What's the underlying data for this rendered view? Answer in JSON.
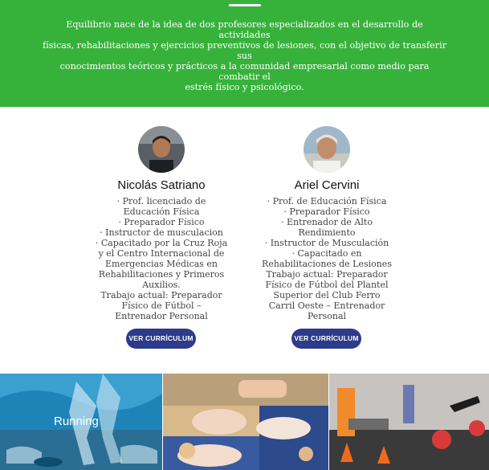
{
  "intro": {
    "lines": [
      "Equilibrio nace de la idea de dos profesores especializados en el desarrollo de actividades",
      "físicas, rehabilitaciones y ejercicios preventivos de lesiones, con el objetivo de transferir sus",
      "conocimientos teóricos y prácticos a la comunidad empresarial como medio para combatir el",
      "estrés físico y psicológico."
    ]
  },
  "team": {
    "members": [
      {
        "name": "Nicolás Satriano",
        "lines": [
          "· Prof. licenciado de",
          "Educación Física",
          "· Preparador Físico",
          "· Instructor de musculacion",
          "· Capacitado por la Cruz Roja",
          "y el Centro Internacional de",
          "Emergencias Médicas en",
          "Rehabilitaciones y Primeros",
          "Auxilios.",
          "Trabajo actual: Preparador",
          "Físico de Fútbol  –",
          "Entrenador Personal"
        ],
        "button_label": "VER CURRÍCULUM"
      },
      {
        "name": "Ariel Cervini",
        "lines": [
          "· Prof. de Educación Física",
          "· Preparador Físico",
          "· Entrenador de Alto",
          "Rendimiento",
          "· Instructor de Musculación",
          "· Capacitado en",
          "Rehabilitaciones de Lesiones",
          "Trabajo actual: Preparador",
          "Físico de Fútbol  del Plantel",
          "Superior del Club Ferro",
          "Carril Oeste – Entrenador",
          "Personal"
        ],
        "button_label": "VER CURRÍCULUM"
      }
    ]
  },
  "gallery": {
    "tiles": [
      {
        "label": "Running",
        "icon": "running-photo"
      },
      {
        "label": "",
        "icon": "stretching-photo"
      },
      {
        "label": "",
        "icon": "training-photo"
      }
    ]
  },
  "colors": {
    "hero_green": "#36b23a",
    "button_navy": "#2e3a8a",
    "name_text": "#111111",
    "body_text": "#444444"
  }
}
